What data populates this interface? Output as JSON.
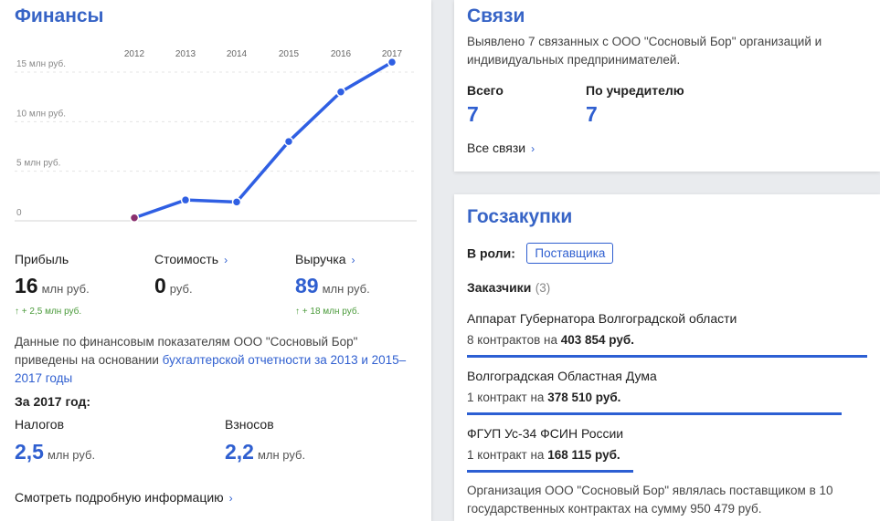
{
  "finance": {
    "title": "Финансы",
    "chart_data": {
      "type": "line",
      "x": [
        "2012",
        "2013",
        "2014",
        "2015",
        "2016",
        "2017"
      ],
      "series": [
        {
          "values": [
            0.3,
            2.1,
            1.9,
            8.0,
            13.0,
            16.0
          ]
        }
      ],
      "y_ticks": [
        "15 млн руб.",
        "10 млн руб.",
        "5 млн руб.",
        "0"
      ],
      "ylim": [
        0,
        16
      ],
      "grid": true
    },
    "metrics": [
      {
        "label": "Прибыль",
        "value": "16",
        "unit": "млн руб.",
        "delta": "↑ + 2,5 млн руб."
      },
      {
        "label": "Стоимость",
        "value": "0",
        "unit": "руб.",
        "delta": ""
      },
      {
        "label": "Выручка",
        "value": "89",
        "unit": "млн руб.",
        "delta": "↑ + 18 млн руб."
      }
    ],
    "note_prefix": "Данные по финансовым показателям ООО \"Сосновый Бор\" приведены на основании ",
    "note_link": "бухгалтерской отчетности за 2013 и 2015–2017 годы",
    "year_heading": "За 2017 год:",
    "taxes": [
      {
        "label": "Налогов",
        "value": "2,5",
        "unit": "млн руб."
      },
      {
        "label": "Взносов",
        "value": "2,2",
        "unit": "млн руб."
      }
    ],
    "more_link": "Смотреть подробную информацию"
  },
  "connections": {
    "title": "Связи",
    "description": "Выявлено 7 связанных с ООО \"Сосновый Бор\" организаций и индивидуальных предпринимателей.",
    "total_label": "Всего",
    "total_value": "7",
    "founder_label": "По учредителю",
    "founder_value": "7",
    "all_link": "Все связи"
  },
  "procurement": {
    "title": "Госзакупки",
    "role_label": "В роли:",
    "role_value": "Поставщика",
    "customers_label": "Заказчики",
    "customers_count": "(3)",
    "customers": [
      {
        "name": "Аппарат Губернатора Волгоградской области",
        "contracts": "8 контрактов на",
        "amount": "403 854 руб.",
        "share": 1.0
      },
      {
        "name": "Волгоградская Областная Дума",
        "contracts": "1 контракт на",
        "amount": "378 510 руб.",
        "share": 0.937
      },
      {
        "name": "ФГУП Ус-34 ФСИН России",
        "contracts": "1 контракт на",
        "amount": "168 115 руб.",
        "share": 0.416
      }
    ],
    "summary": "Организация ООО \"Сосновый Бор\" являлась поставщиком в 10 государственных контрактах на сумму 950 479 руб."
  }
}
